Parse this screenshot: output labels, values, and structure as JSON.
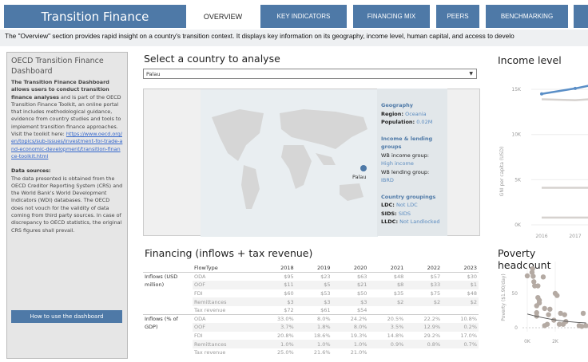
{
  "header": {
    "title": "Transition Finance",
    "tabs": [
      {
        "label": "OVERVIEW",
        "active": true
      },
      {
        "label": "KEY INDICATORS"
      },
      {
        "label": "FINANCING MIX"
      },
      {
        "label": "PEERS"
      },
      {
        "label": "BENCHMARKING"
      },
      {
        "label": ""
      }
    ],
    "description": "The \"Overview\" section provides rapid insight on a country's transition context. It displays key information on its geography, income level, human capital, and access to develo"
  },
  "sidebar": {
    "title": "OECD Transition Finance Dashboard",
    "intro_bold": "The Transition Finance Dashboard allows users to conduct transition finance analyses",
    "intro_rest": " and is part of the OECD Transition Finance Toolkit, an online portal that includes methodological guidance, evidence from country studies and tools to implement transition finance approaches. Visit the toolkit here: ",
    "link": "https://www.oecd.org/en/topics/sub-issues/investment-for-trade-and-economic-development/transition-finance-toolkit.html",
    "sources_title": "Data sources:",
    "sources_text": "The data presented is obtained from the OECD Creditor Reporting System (CRS) and the World Bank's World Development Indicators (WDI) databases. The OECD does not vouch for the validity of data coming from third party sources. In case of discrepancy to OECD statistics, the original CRS figures shall prevail.",
    "button": "How to use the dashboard"
  },
  "selector": {
    "title": "Select a country to analyse",
    "value": "Palau",
    "dropdown_icon": "triangle-down"
  },
  "map": {
    "marker_label": "Palau",
    "marker_color": "#4e79a7"
  },
  "info": {
    "geo_title": "Geography",
    "region_label": "Region:",
    "region": "Oceania",
    "pop_label": "Population:",
    "population": "0.02M",
    "income_title": "Income & lending groups",
    "income_label": "WB income group:",
    "income": "High income",
    "lending_label": "WB lending group:",
    "lending": "IBRD",
    "groups_title": "Country groupings",
    "ldc_label": "LDC:",
    "ldc": "Not LDC",
    "sids_label": "SIDS:",
    "sids": "SIDS",
    "lldc_label": "LLDC:",
    "lldc": "Not Landlocked"
  },
  "financing": {
    "title": "Financing (inflows + tax revenue)",
    "flow_header": "FlowType",
    "years": [
      "2018",
      "2019",
      "2020",
      "2021",
      "2022",
      "2023"
    ],
    "groups": [
      {
        "label": "Inflows (USD million)",
        "rows": [
          [
            "ODA",
            "$95",
            "$23",
            "$63",
            "$48",
            "$57",
            "$30"
          ],
          [
            "OOF",
            "$11",
            "$5",
            "$21",
            "$8",
            "$33",
            "$1"
          ],
          [
            "FDI",
            "$60",
            "$53",
            "$50",
            "$35",
            "$75",
            "$48"
          ],
          [
            "Remittances",
            "$3",
            "$3",
            "$3",
            "$2",
            "$2",
            "$2"
          ],
          [
            "Tax revenue",
            "$72",
            "$61",
            "$54",
            "",
            "",
            ""
          ]
        ]
      },
      {
        "label": "Inflows (% of GDP)",
        "rows": [
          [
            "ODA",
            "33.0%",
            "8.0%",
            "24.2%",
            "20.5%",
            "22.2%",
            "10.8%"
          ],
          [
            "OOF",
            "3.7%",
            "1.8%",
            "8.0%",
            "3.5%",
            "12.9%",
            "0.2%"
          ],
          [
            "FDI",
            "20.8%",
            "18.6%",
            "19.3%",
            "14.8%",
            "29.2%",
            "17.0%"
          ],
          [
            "Remittances",
            "1.0%",
            "1.0%",
            "1.0%",
            "0.9%",
            "0.8%",
            "0.7%"
          ],
          [
            "Tax revenue",
            "25.0%",
            "21.6%",
            "21.0%",
            "",
            "",
            ""
          ]
        ]
      }
    ]
  },
  "chart_data": [
    {
      "type": "line",
      "title": "Income level",
      "ylabel": "GNI per capita (USD)",
      "yticks": [
        "0K",
        "5K",
        "10K",
        "15K"
      ],
      "xticks": [
        "2016",
        "2017"
      ],
      "ylim": [
        0,
        15500
      ],
      "series": [
        {
          "color": "#5b8fc7",
          "x": [
            2016,
            2017,
            2017.4
          ],
          "y": [
            14500,
            15100,
            15400
          ]
        },
        {
          "color": "#d6d2cf",
          "x": [
            2016,
            2017,
            2017.4
          ],
          "y": [
            13900,
            13800,
            13900
          ]
        },
        {
          "color": "#d6d2cf",
          "x": [
            2016,
            2017,
            2017.4
          ],
          "y": [
            4100,
            4100,
            4100
          ]
        },
        {
          "color": "#d6d2cf",
          "x": [
            2016,
            2017,
            2017.4
          ],
          "y": [
            800,
            800,
            800
          ]
        }
      ]
    },
    {
      "type": "scatter",
      "title": "Poverty headcount",
      "ylabel": "Poverty ($1.90/day)",
      "yticks": [
        "0",
        "50"
      ],
      "xticks": [
        "0K",
        "2K"
      ],
      "color": "#b4aaa3",
      "points": [
        [
          0,
          75.6
        ],
        [
          0.38,
          86
        ],
        [
          0.34,
          80.6
        ],
        [
          0.42,
          75
        ],
        [
          0.47,
          67
        ],
        [
          0.76,
          61
        ],
        [
          1.14,
          74
        ],
        [
          0.53,
          61
        ],
        [
          0.76,
          44
        ],
        [
          0.86,
          40
        ],
        [
          0.86,
          36
        ],
        [
          0.67,
          32
        ],
        [
          0.67,
          22
        ],
        [
          0.67,
          17
        ],
        [
          1.24,
          28
        ],
        [
          1.62,
          27
        ],
        [
          1.52,
          19
        ],
        [
          2.0,
          50
        ],
        [
          2.13,
          47
        ],
        [
          1.24,
          3
        ],
        [
          1.43,
          5
        ],
        [
          1.9,
          11
        ],
        [
          2.38,
          21
        ],
        [
          2.67,
          19
        ],
        [
          2.29,
          5
        ],
        [
          2.57,
          5
        ],
        [
          2.76,
          9
        ],
        [
          4.0,
          21
        ],
        [
          3.71,
          3
        ],
        [
          3.9,
          2
        ],
        [
          4.19,
          3
        ]
      ],
      "trend": [
        [
          0,
          20
        ],
        [
          4.2,
          7
        ]
      ]
    }
  ]
}
